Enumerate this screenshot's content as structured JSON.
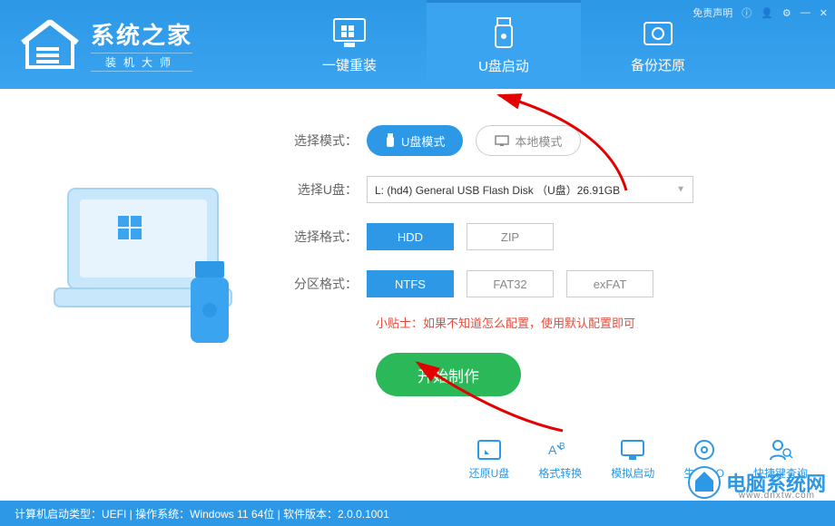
{
  "header": {
    "brand_title": "系统之家",
    "brand_sub": "装机大师",
    "disclaimer": "免责声明"
  },
  "nav": {
    "reinstall": "一键重装",
    "usb_boot": "U盘启动",
    "backup": "备份还原"
  },
  "form": {
    "mode_label": "选择模式：",
    "mode_usb": "U盘模式",
    "mode_local": "本地模式",
    "usb_label": "选择U盘：",
    "usb_value": "L: (hd4) General USB Flash Disk （U盘）26.91GB",
    "fmt_label": "选择格式：",
    "fmt_hdd": "HDD",
    "fmt_zip": "ZIP",
    "part_label": "分区格式：",
    "part_ntfs": "NTFS",
    "part_fat32": "FAT32",
    "part_exfat": "exFAT",
    "tip": "小贴士：如果不知道怎么配置，使用默认配置即可",
    "start": "开始制作"
  },
  "bottom": {
    "restore": "还原U盘",
    "convert": "格式转换",
    "sim": "模拟启动",
    "iso": "生成ISO",
    "hotkey": "快捷键查询"
  },
  "status": {
    "text": "计算机启动类型：UEFI | 操作系统：Windows 11 64位 | 软件版本：2.0.0.1001"
  },
  "watermark": {
    "title": "电脑系统网",
    "url": "www.dnxtw.com"
  }
}
